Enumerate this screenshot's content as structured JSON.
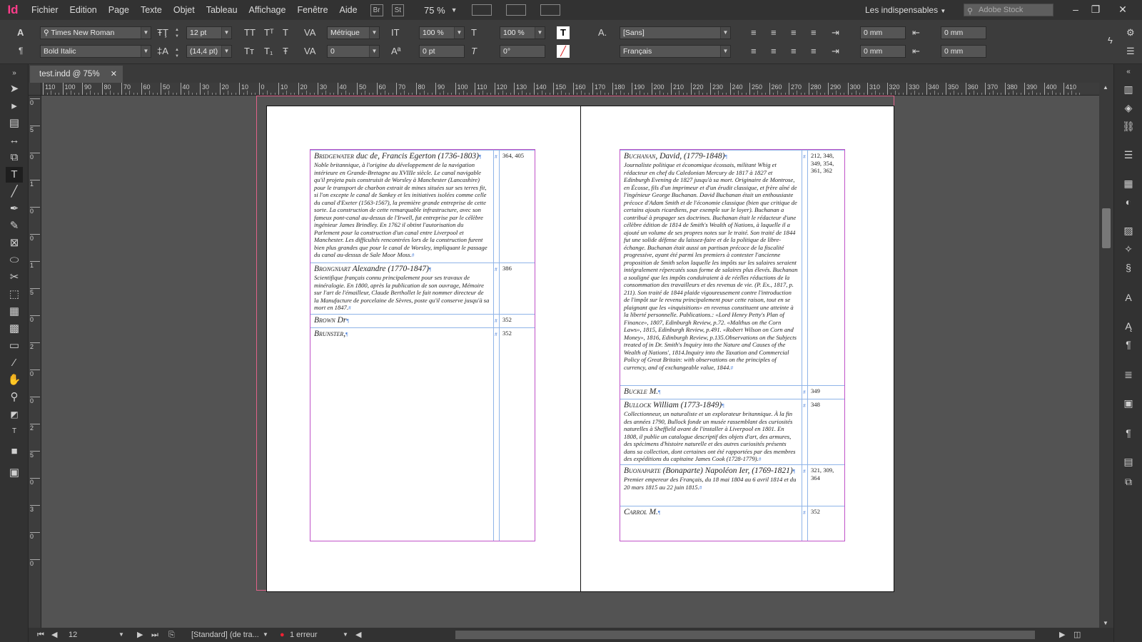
{
  "app": {
    "logo": "Id",
    "menu": [
      "Fichier",
      "Edition",
      "Page",
      "Texte",
      "Objet",
      "Tableau",
      "Affichage",
      "Fenêtre",
      "Aide"
    ],
    "br": "Br",
    "st": "St",
    "zoom": "75 %",
    "workspace": "Les indispensables",
    "search_placeholder": "Adobe Stock"
  },
  "control": {
    "font_family": "Times New Roman",
    "font_style": "Bold Italic",
    "font_size": "12 pt",
    "leading": "(14,4 pt)",
    "kerning": "Métrique",
    "tracking": "0",
    "vscale": "100 %",
    "hscale": "100 %",
    "baseline": "0 pt",
    "skew": "0°",
    "char_style": "[Sans]",
    "language": "Français",
    "indent_left": "0 mm",
    "indent_right": "0 mm",
    "space_before": "0 mm",
    "space_after": "0 mm"
  },
  "document": {
    "tab_title": "test.indd @ 75%"
  },
  "ruler": {
    "h_ticks": [
      "110",
      "100",
      "90",
      "80",
      "70",
      "60",
      "50",
      "40",
      "30",
      "20",
      "10",
      "0",
      "10",
      "20",
      "30",
      "40",
      "50",
      "60",
      "70",
      "80",
      "90",
      "100",
      "110",
      "120",
      "130",
      "140",
      "150",
      "160",
      "170",
      "180",
      "190",
      "200",
      "210",
      "220",
      "230",
      "240",
      "250",
      "260",
      "270",
      "280",
      "290",
      "300",
      "310",
      "320",
      "330",
      "340",
      "350",
      "360",
      "370",
      "380",
      "390",
      "400",
      "410"
    ],
    "v_ticks": [
      "0",
      "5",
      "0",
      "1",
      "0",
      "0",
      "1",
      "5",
      "0",
      "2",
      "0",
      "0",
      "2",
      "5",
      "0",
      "3",
      "0",
      "0"
    ]
  },
  "status": {
    "page": "12",
    "style": "[Standard] (de tra...",
    "errors": "1 erreur"
  },
  "left_entries": [
    {
      "name": "Bridgewater",
      "rest": " duc de, Francis Egerton (1736-1803)",
      "body": "Noble britannique, à l'origine du développement de la navigation intérieure en Grande-Bretagne au XVIIIe siècle. Le canal navigable qu'il projeta puis construisit de Worsley à Manchester (Lancashire) pour le transport de charbon extrait de mines situées sur ses terres fit, si l'on excepte le canal de Sankey et les initiatives isolées comme celle du canal d'Exeter (1563-1567), la première grande entreprise de cette sorte. La construction de cette remarquable infrastructure, avec son fameux pont-canal au-dessus de l'Irwell, fut entreprise par le célèbre ingénieur James Brindley. En 1762 il obtint l'autorisation du Parlement pour la construction d'un canal entre Liverpool et Manchester. Les difficultés rencontrées lors de la construction furent bien plus grandes que pour le canal de Worsley, impliquant le passage du canal au-dessus de Sale Moor Moss.",
      "pages": "364, 405"
    },
    {
      "name": "Brongniart",
      "rest": " Alexandre (1770-1847)",
      "body": "Scientifique français connu principalement pour ses travaux de minéralogie. En 1800, après la publication de son ouvrage, Mémoire sur l'art de l'émailleur, Claude Berthollet le fait nommer directeur de la Manufacture de porcelaine de Sèvres, poste qu'il conserve jusqu'à sa mort en 1847.",
      "pages": "386"
    },
    {
      "name": "Brown",
      "rest": " Dr",
      "body": "",
      "pages": "352"
    },
    {
      "name": "Brunster,",
      "rest": "",
      "body": "",
      "pages": "352"
    }
  ],
  "right_entries": [
    {
      "name": "Buchanan,",
      "rest": " David, (1779-1848)",
      "body": "Journaliste politique et économique écossais, militant Whig et rédacteur en chef du Caledonian Mercury de 1817 à 1827 et Edinburgh Evening de 1827 jusqu'à sa mort. Originaire de Montrose, en Écosse, fils d'un imprimeur et d'un érudit classique, et frère aîné de l'ingénieur George Buchanan. David Buchanan était un enthousiaste précoce d'Adam Smith et de l'économie classique (bien que critique de certains ajouts ricardiens, par exemple sur le loyer). Buchanan a contribué à propager ses doctrines. Buchanan était le rédacteur d'une célèbre édition de 1814 de Smith's Wealth of Nations, à laquelle il a ajouté un volume de ses propres notes sur le traité. Son traité de 1844 fut une solide défense du laissez-faire et de la politique de libre-échange. Buchanan était aussi un partisan précoce de la fiscalité progressive, ayant été parmi les premiers à contester l'ancienne proposition de Smith selon laquelle les impôts sur les salaires seraient intégralement répercutés sous forme de salaires plus élevés. Buchanan a souligné que les impôts conduiraient à de réelles réductions de la consommation des travailleurs et des revenus de vie. (P. Ex., 1817, p. 211). Son traité de 1844 plaide vigoureusement contre l'introduction de l'impôt sur le revenu principalement pour cette raison, tout en se plaignant que les «inquisitions» en revenus constituent une atteinte à la liberté personnelle. Publications.: «Lord Henry Petty's Plan of Finance», 1807, Edinburgh Review, p.72. «Malthus on the Corn Laws», 1815, Edinburgh Review, p.491. «Robert Wilson on Corn and Money», 1816, Edinburgh Review, p.135.Observations on the Subjects treated of in Dr. Smith's Inquiry into the Nature and Causes of the Wealth of Nations', 1814.Inquiry into the Taxation and Commercial Policy of Great Britain: with observations on the principles of currency, and of exchangeable value, 1844.",
      "pages": "212, 348, 349, 354, 361, 362"
    },
    {
      "name": "Buckle",
      "rest": " M.",
      "body": "",
      "pages": "349"
    },
    {
      "name": "Bullock",
      "rest": " William (1773-1849)",
      "body": "Collectionneur, un naturaliste et un explorateur britannique. À la fin des années 1790, Bullock fonde un musée rassemblant des curiosités naturelles à Sheffield avant de l'installer à Liverpool en 1801. En 1808, il publie un catalogue descriptif des objets d'art, des armures, des spécimens d'histoire naturelle et des autres curiosités présents dans sa collection, dont certaines ont été rapportées par des membres des expéditions du capitaine James Cook (1728-1779).",
      "pages": "348"
    },
    {
      "name": "Buonaparte",
      "rest": " (Bonaparte) Napoléon Ier, (1769-1821)",
      "body": "Premier empereur des Français, du 18 mai 1804 au 6 avril 1814 et du 20 mars 1815 au 22 juin 1815.",
      "pages": "321, 309, 364"
    },
    {
      "name": "Carrol",
      "rest": " M.",
      "body": "",
      "pages": "352"
    }
  ],
  "colors": {
    "accent": "#ff3c8a",
    "frame": "#c052c8",
    "table_rule": "#8fb4e8",
    "bleed": "#e0628a"
  }
}
